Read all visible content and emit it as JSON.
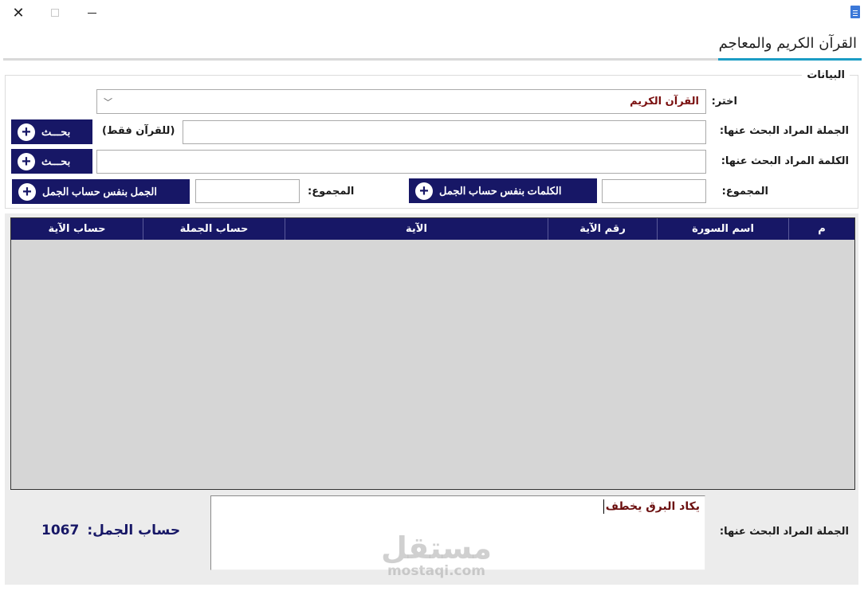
{
  "window": {
    "close_icon": "close-icon",
    "max_icon": "maximize-icon",
    "min_icon": "minimize-icon",
    "app_icon": "document-icon"
  },
  "tab": {
    "title": "القرآن الكريم والمعاجم"
  },
  "group": {
    "title": "البيانات"
  },
  "form": {
    "choose_label": "اختر:",
    "choose_value": "القرآن الكريم",
    "sentence_label": "الجملة المراد البحث عنها:",
    "sentence_value": "",
    "quran_only": "(للقرآن فقط)",
    "search_label": "بحـــث",
    "word_label": "الكلمة المراد البحث عنها:",
    "word_value": "",
    "search2_label": "بحـــث",
    "total_label": "المجموع:",
    "total_value": "",
    "words_same_jumal": "الكلمات بنفس حساب الجمل",
    "total2_label": "المجموع:",
    "total2_value": "",
    "sentences_same_jumal": "الجمل بنفس حساب الجمل"
  },
  "grid": {
    "columns": [
      "م",
      "اسم السورة",
      "رقم الآية",
      "الآية",
      "حساب الجملة",
      "حساب الآية"
    ]
  },
  "bottom": {
    "label": "الجملة المراد البحث عنها:",
    "text": "يكاد البرق يخطف",
    "jumal_label": "حساب الجمل:",
    "jumal_value": "1067"
  },
  "watermark": {
    "ar": "مستقل",
    "en": "mostaqi.com"
  },
  "colors": {
    "navy": "#171766",
    "accent": "#1b9cc4",
    "maroon": "#7a1010"
  }
}
